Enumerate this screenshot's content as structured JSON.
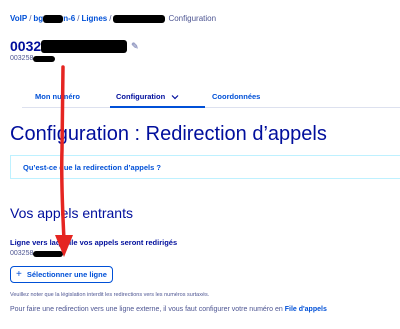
{
  "breadcrumb": {
    "item1": "VoIP",
    "item2_prefix": "bg",
    "item2_suffix": "n-6",
    "item3": "Lignes",
    "current": "Configuration",
    "separator": "/"
  },
  "line": {
    "number_visible": "0032",
    "sub_visible": "003258",
    "edit_icon": "pencil-icon"
  },
  "tabs": [
    {
      "label": "Mon numéro"
    },
    {
      "label": "Configuration"
    },
    {
      "label": "Coordonnées"
    }
  ],
  "tab_dropdown_icon": "chevron-down-icon",
  "page_title": "Configuration : Redirection d’appels",
  "faq_link": "Qu’est-ce que la redirection d’appels ?",
  "section_title": "Vos appels entrants",
  "redirect": {
    "label": "Ligne vers laquelle vos appels seront redirigés",
    "value_visible": "003258",
    "select_button": "Sélectionner une ligne"
  },
  "note_legal": "Veuillez noter que la législation interdit les redirections vers les numéros surtaxés.",
  "note_external_prefix": "Pour faire une redirection vers une ligne externe, il vous faut configurer votre numéro en",
  "note_external_link": "File d'appels",
  "colors": {
    "primary_blue": "#0050d7",
    "heading_navy": "#000e9c",
    "muted_text": "#4d5592",
    "annotation_red": "#e52521",
    "redaction": "#000000"
  }
}
